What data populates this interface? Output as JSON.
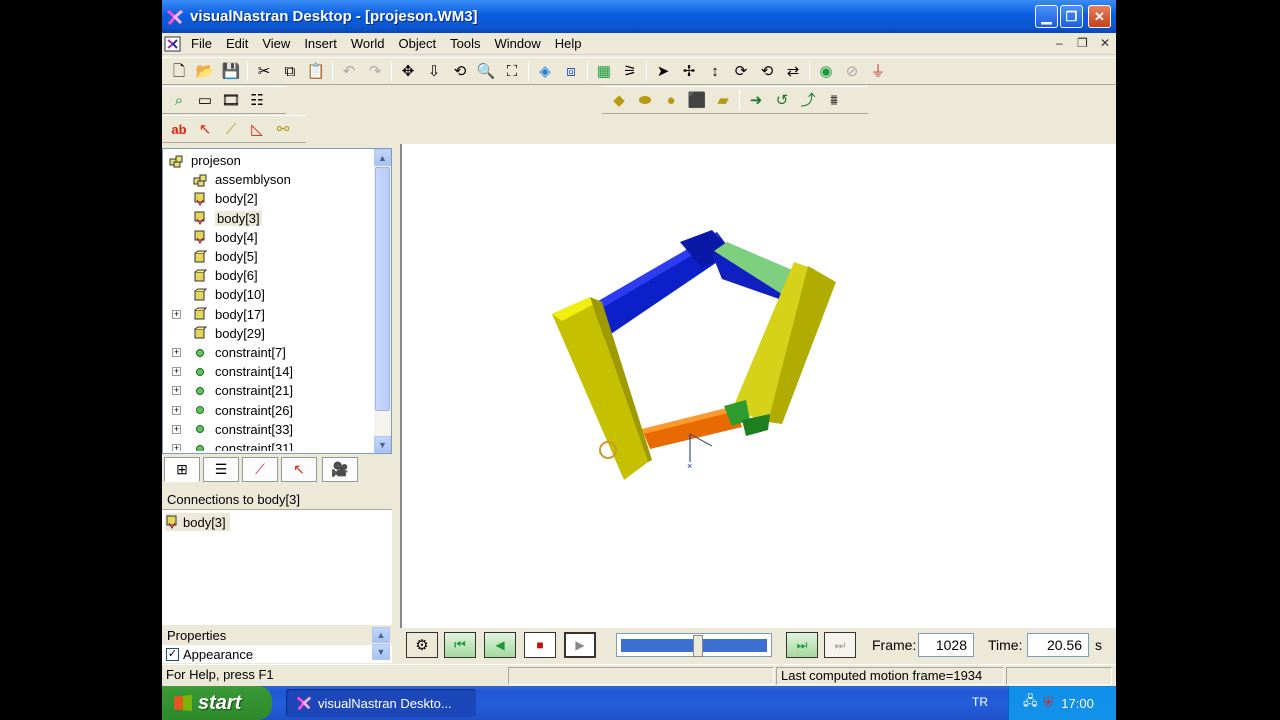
{
  "window": {
    "title": "visualNastran Desktop - [projeson.WM3]"
  },
  "menu": [
    "File",
    "Edit",
    "View",
    "Insert",
    "World",
    "Object",
    "Tools",
    "Window",
    "Help"
  ],
  "tree": {
    "items": [
      {
        "label": "projeson",
        "icon": "assembly-icon",
        "expander": false,
        "indent": 0
      },
      {
        "label": "assemblyson",
        "icon": "assembly-icon",
        "expander": false,
        "indent": 1
      },
      {
        "label": "body[2]",
        "icon": "body-connected-icon",
        "expander": false,
        "indent": 1
      },
      {
        "label": "body[3]",
        "icon": "body-connected-icon",
        "expander": false,
        "indent": 1,
        "selected": true
      },
      {
        "label": "body[4]",
        "icon": "body-connected-icon",
        "expander": false,
        "indent": 1
      },
      {
        "label": "body[5]",
        "icon": "body-icon",
        "expander": false,
        "indent": 1
      },
      {
        "label": "body[6]",
        "icon": "body-icon",
        "expander": false,
        "indent": 1
      },
      {
        "label": "body[10]",
        "icon": "body-icon",
        "expander": false,
        "indent": 1
      },
      {
        "label": "body[17]",
        "icon": "body-icon",
        "expander": true,
        "indent": 1
      },
      {
        "label": "body[29]",
        "icon": "body-icon",
        "expander": false,
        "indent": 1
      },
      {
        "label": "constraint[7]",
        "icon": "constraint-icon",
        "expander": true,
        "indent": 1
      },
      {
        "label": "constraint[14]",
        "icon": "constraint-icon",
        "expander": true,
        "indent": 1
      },
      {
        "label": "constraint[21]",
        "icon": "constraint-icon",
        "expander": true,
        "indent": 1
      },
      {
        "label": "constraint[26]",
        "icon": "constraint-icon",
        "expander": true,
        "indent": 1
      },
      {
        "label": "constraint[33]",
        "icon": "constraint-icon",
        "expander": true,
        "indent": 1
      },
      {
        "label": "constraint[31]",
        "icon": "constraint-icon",
        "expander": true,
        "indent": 1
      }
    ]
  },
  "connections": {
    "header": "Connections to body[3]",
    "items": [
      "body[3]"
    ]
  },
  "properties": {
    "header": "Properties",
    "appearance_label": "Appearance",
    "appearance_checked": true
  },
  "playback": {
    "frame_label": "Frame:",
    "frame_value": "1028",
    "time_label": "Time:",
    "time_value": "20.56",
    "time_unit": "s",
    "progress": 0.53
  },
  "status": {
    "help": "For Help, press F1",
    "motion": "Last computed motion frame=1934"
  },
  "taskbar": {
    "start": "start",
    "task": "visualNastran Deskto...",
    "lang": "TR",
    "clock": "17:00"
  },
  "colors": {
    "titlebar": "#0b57d0",
    "viewport": "#ffffff",
    "taskbar": "#245edb",
    "start": "#379634"
  }
}
